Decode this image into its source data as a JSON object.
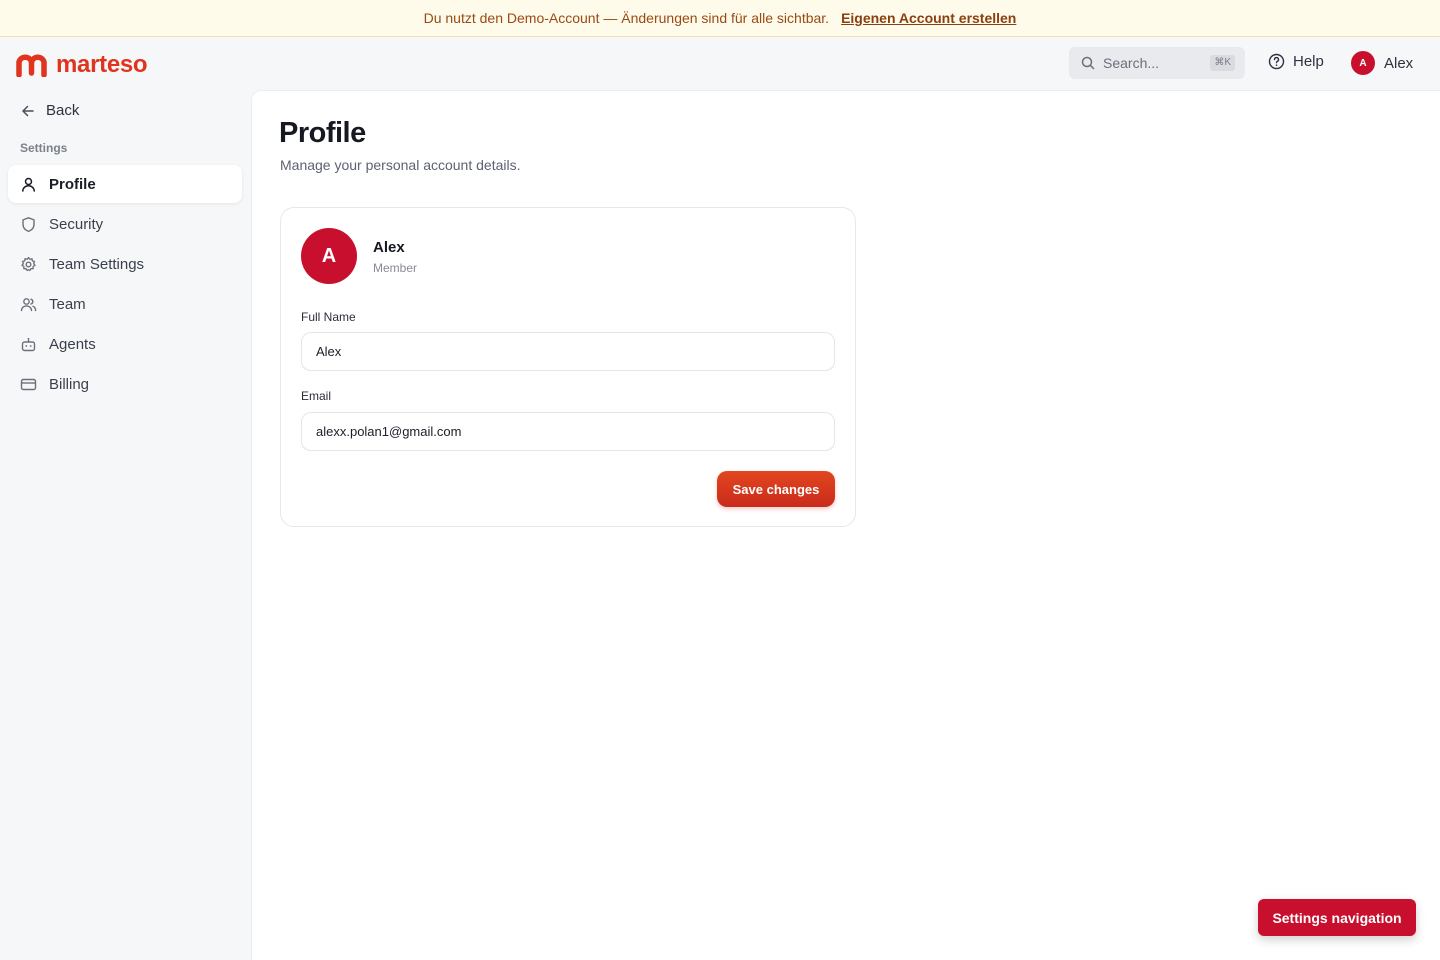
{
  "banner": {
    "message": "Du nutzt den Demo-Account — Änderungen sind für alle sichtbar.",
    "cta": "Eigenen Account erstellen"
  },
  "header": {
    "brand": "marteso",
    "search_placeholder": "Search...",
    "search_shortcut": "⌘K",
    "help_label": "Help",
    "user_initial": "A",
    "user_name": "Alex"
  },
  "sidebar": {
    "back_label": "Back",
    "section_label": "Settings",
    "items": [
      {
        "label": "Profile",
        "icon": "user-icon",
        "active": true
      },
      {
        "label": "Security",
        "icon": "shield-icon",
        "active": false
      },
      {
        "label": "Team Settings",
        "icon": "gear-icon",
        "active": false
      },
      {
        "label": "Team",
        "icon": "users-icon",
        "active": false
      },
      {
        "label": "Agents",
        "icon": "bot-icon",
        "active": false
      },
      {
        "label": "Billing",
        "icon": "credit-card-icon",
        "active": false
      }
    ]
  },
  "main": {
    "title": "Profile",
    "subtitle": "Manage your personal account details.",
    "card": {
      "avatar_initial": "A",
      "name": "Alex",
      "role": "Member",
      "full_name_label": "Full Name",
      "full_name_value": "Alex",
      "email_label": "Email",
      "email_value": "alexx.polan1@gmail.com",
      "save_label": "Save changes"
    }
  },
  "floating": {
    "label": "Settings navigation"
  },
  "colors": {
    "brand": "#e0341e",
    "accent": "#c8102e",
    "banner_bg": "#fefbea"
  }
}
